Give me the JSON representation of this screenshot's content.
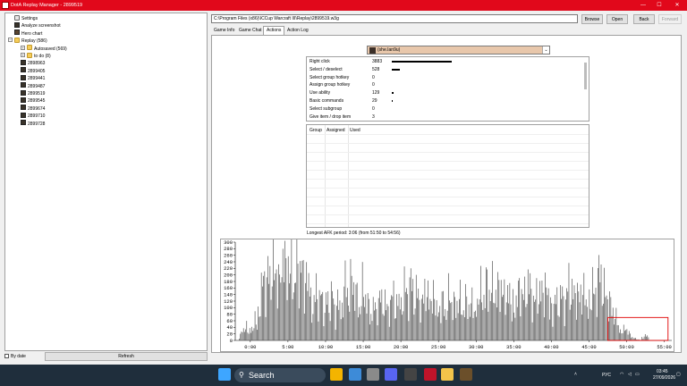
{
  "window": {
    "title": "DotA Replay Manager - 2899519"
  },
  "window_controls": {
    "minimize": "—",
    "maximize": "☐",
    "close": "✕"
  },
  "tree": {
    "items": [
      {
        "label": "Settings",
        "icon": "settings-icon",
        "indent": 1,
        "expander": ""
      },
      {
        "label": "Analyze screenshot",
        "icon": "screenshot-icon",
        "indent": 1,
        "expander": ""
      },
      {
        "label": "Hero chart",
        "icon": "hero-chart-icon",
        "indent": 1,
        "expander": ""
      },
      {
        "label": "Replay (586)",
        "icon": "folder-icon",
        "indent": 0,
        "expander": "−"
      },
      {
        "label": "Autosaved (569)",
        "icon": "folder-icon",
        "indent": 2,
        "expander": "+"
      },
      {
        "label": "to do (8)",
        "icon": "folder-icon",
        "indent": 2,
        "expander": "+"
      },
      {
        "label": "2898963",
        "icon": "replay-icon",
        "indent": 2,
        "expander": ""
      },
      {
        "label": "2899405",
        "icon": "replay-icon",
        "indent": 2,
        "expander": ""
      },
      {
        "label": "2899441",
        "icon": "replay-icon",
        "indent": 2,
        "expander": ""
      },
      {
        "label": "2899487",
        "icon": "replay-icon",
        "indent": 2,
        "expander": ""
      },
      {
        "label": "2899519",
        "icon": "replay-icon",
        "indent": 2,
        "expander": ""
      },
      {
        "label": "2899545",
        "icon": "replay-icon",
        "indent": 2,
        "expander": ""
      },
      {
        "label": "2899674",
        "icon": "replay-icon",
        "indent": 2,
        "expander": ""
      },
      {
        "label": "2899710",
        "icon": "replay-icon",
        "indent": 2,
        "expander": ""
      },
      {
        "label": "2899728",
        "icon": "replay-icon",
        "indent": 2,
        "expander": ""
      }
    ]
  },
  "bottom_left": {
    "by_date_label": "By date",
    "refresh_label": "Refresh"
  },
  "toolbar": {
    "path": "C:\\Program Files (x86)\\ICCup Warcraft III\\Replay\\2899519.w3g",
    "browse": "Browse",
    "open": "Open",
    "back": "Back",
    "forward": "Forward"
  },
  "tabs": [
    {
      "label": "Game Info",
      "active": false
    },
    {
      "label": "Game Chat",
      "active": false
    },
    {
      "label": "Actions",
      "active": true
    },
    {
      "label": "Action Log",
      "active": false
    }
  ],
  "player": {
    "name": "(she.Ian9u)"
  },
  "actions": [
    {
      "label": "Right click",
      "value": "3883",
      "fraction": 1.0
    },
    {
      "label": "Select / deselect",
      "value": "528",
      "fraction": 0.136
    },
    {
      "label": "Select group hotkey",
      "value": "0",
      "fraction": 0
    },
    {
      "label": "Assign group hotkey",
      "value": "0",
      "fraction": 0
    },
    {
      "label": "Use ability",
      "value": "129",
      "fraction": 0.033
    },
    {
      "label": "Basic commands",
      "value": "29",
      "fraction": 0.0075
    },
    {
      "label": "Select subgroup",
      "value": "0",
      "fraction": 0
    },
    {
      "label": "Give item / drop item",
      "value": "3",
      "fraction": 0
    }
  ],
  "groups_table": {
    "columns": [
      "Group",
      "Assigned",
      "Used"
    ]
  },
  "apm": {
    "longest_afk": "Longest AFK period: 3:06 (from 51:50 to 54:56)"
  },
  "chart_data": {
    "type": "bar",
    "title": "",
    "xlabel": "",
    "ylabel": "",
    "ylim": [
      0,
      300
    ],
    "yticks": [
      0,
      20,
      40,
      60,
      80,
      100,
      120,
      140,
      160,
      180,
      200,
      220,
      240,
      260,
      280,
      300
    ],
    "xlim": [
      -2,
      56
    ],
    "xticks": [
      {
        "value": 0,
        "label": "0:00"
      },
      {
        "value": 5,
        "label": "5:00"
      },
      {
        "value": 10,
        "label": "10:00"
      },
      {
        "value": 15,
        "label": "15:00"
      },
      {
        "value": 20,
        "label": "20:00"
      },
      {
        "value": 25,
        "label": "25:00"
      },
      {
        "value": 30,
        "label": "30:00"
      },
      {
        "value": 35,
        "label": "35:00"
      },
      {
        "value": 40,
        "label": "40:00"
      },
      {
        "value": 45,
        "label": "45:00"
      },
      {
        "value": 50,
        "label": "50:00"
      },
      {
        "value": 55,
        "label": "55:00"
      }
    ],
    "segments": [
      {
        "x": [
          -1.5,
          1
        ],
        "values": [
          8,
          35,
          20,
          60,
          15,
          45,
          30,
          70,
          25
        ]
      },
      {
        "x": [
          1,
          4
        ],
        "values": [
          80,
          120,
          160,
          200,
          150,
          210,
          180,
          230,
          190,
          220,
          170,
          140
        ]
      },
      {
        "x": [
          4,
          8
        ],
        "values": [
          240,
          260,
          200,
          250,
          180,
          220,
          150,
          270,
          190,
          230,
          160,
          210,
          140,
          180
        ]
      },
      {
        "x": [
          8,
          12
        ],
        "values": [
          120,
          90,
          160,
          110,
          140,
          80,
          130,
          100,
          150,
          70,
          120,
          95
        ]
      },
      {
        "x": [
          12,
          16
        ],
        "values": [
          80,
          140,
          180,
          110,
          200,
          150,
          120,
          90,
          160,
          130,
          100,
          85
        ]
      },
      {
        "x": [
          16,
          20
        ],
        "values": [
          90,
          120,
          70,
          150,
          100,
          130,
          80,
          110,
          140,
          95,
          120,
          75
        ]
      },
      {
        "x": [
          20,
          25
        ],
        "values": [
          100,
          160,
          130,
          180,
          120,
          150,
          90,
          170,
          110,
          140,
          100,
          130
        ]
      },
      {
        "x": [
          25,
          30
        ],
        "values": [
          90,
          120,
          80,
          140,
          110,
          100,
          130,
          85,
          120,
          95,
          110,
          80
        ]
      },
      {
        "x": [
          30,
          35
        ],
        "values": [
          110,
          150,
          120,
          170,
          140,
          160,
          130,
          180,
          120,
          150,
          110,
          140
        ]
      },
      {
        "x": [
          35,
          40
        ],
        "values": [
          100,
          130,
          160,
          120,
          180,
          140,
          110,
          150,
          130,
          170,
          120,
          160
        ]
      },
      {
        "x": [
          40,
          45
        ],
        "values": [
          90,
          120,
          110,
          140,
          100,
          180,
          130,
          150,
          120,
          160,
          110,
          130
        ]
      },
      {
        "x": [
          45,
          49
        ],
        "values": [
          120,
          160,
          130,
          180,
          210,
          150,
          140,
          120,
          100,
          80,
          60,
          40
        ]
      },
      {
        "x": [
          49,
          52
        ],
        "values": [
          35,
          25,
          40,
          20,
          10,
          5,
          3,
          0
        ]
      },
      {
        "x": [
          52,
          53
        ],
        "values": [
          8,
          15,
          12,
          10
        ]
      }
    ],
    "highlight": {
      "x": [
        47.5,
        55.5
      ],
      "y": [
        0,
        70
      ],
      "color": "#e00000"
    }
  },
  "taskbar": {
    "search_label": "Search",
    "tray_lang": "РУС",
    "time": "03:45",
    "date": "27/09/2026",
    "apps": [
      {
        "name": "windows-start-icon",
        "color": "#3ea6ff"
      },
      {
        "name": "chrome-icon",
        "color": "#f4b400"
      },
      {
        "name": "notepad-icon",
        "color": "#3d8bd8"
      },
      {
        "name": "settings-icon",
        "color": "#8a8a8a"
      },
      {
        "name": "discord-icon",
        "color": "#5865f2"
      },
      {
        "name": "app-icon",
        "color": "#444444"
      },
      {
        "name": "replay-app-icon",
        "color": "#c0142a"
      },
      {
        "name": "file-explorer-icon",
        "color": "#f3c44a"
      },
      {
        "name": "game-icon",
        "color": "#6b4f2a"
      }
    ]
  }
}
